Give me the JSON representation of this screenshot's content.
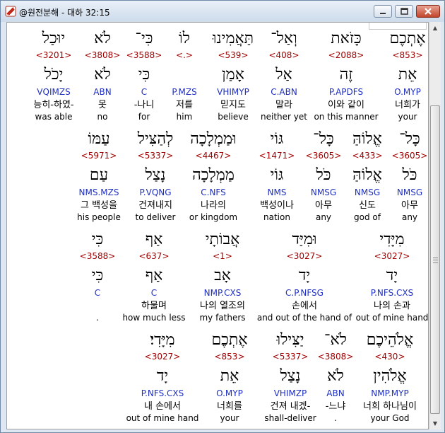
{
  "window": {
    "title": "@원전분해 - 대하 32:15",
    "controls": {
      "minimize": "—",
      "maximize": "□",
      "close": "✕"
    }
  },
  "rows": [
    [
      {
        "heb": "יוּכַל",
        "strong": "<3201>",
        "lemma": "יָכֹל",
        "morph": "VQIMZS",
        "kor": "능히-하였-",
        "eng": "was able"
      },
      {
        "heb": "לֹא",
        "strong": "<3808>",
        "lemma": "לֹא",
        "morph": "ABN",
        "kor": "못",
        "eng": "no"
      },
      {
        "heb": "כִּי־",
        "strong": "<3588>",
        "lemma": "כִּי",
        "morph": "C",
        "kor": "-나니",
        "eng": "for"
      },
      {
        "heb": "לוֹ",
        "strong": "<.>",
        "lemma": "",
        "morph": "P.MZS",
        "kor": "저를",
        "eng": "him"
      },
      {
        "heb": "תַּאֲמִינוּ",
        "strong": "<539>",
        "lemma": "אָמַן",
        "morph": "VHIMYP",
        "kor": "믿지도",
        "eng": "believe"
      },
      {
        "heb": "וְאַל־",
        "strong": "<408>",
        "lemma": "אַל",
        "morph": "C.ABN",
        "kor": "말라",
        "eng": "neither yet"
      },
      {
        "heb": "כָּזֹאת",
        "strong": "<2088>",
        "lemma": "זֶה",
        "morph": "P.APDFS",
        "kor": "이와 같이",
        "eng": "on this manner"
      },
      {
        "heb": "אֶתְכֶם",
        "strong": "<853>",
        "lemma": "אֵת",
        "morph": "O.MYP",
        "kor": "너희가",
        "eng": "your"
      }
    ],
    [
      {
        "heb": "עַמּוֹ",
        "strong": "<5971>",
        "lemma": "עַם",
        "morph": "NMS.MZS",
        "kor": "그 백성을",
        "eng": "his people"
      },
      {
        "heb": "לְהַצִּיל",
        "strong": "<5337>",
        "lemma": "נָצַל",
        "morph": "P.VQNG",
        "kor": "건져내지",
        "eng": "to deliver"
      },
      {
        "heb": "וּמַמְלָכָה",
        "strong": "<4467>",
        "lemma": "מַמְלָכָה",
        "morph": "C.NFS",
        "kor": "나라의",
        "eng": "or kingdom"
      },
      {
        "heb": "גּוֹי",
        "strong": "<1471>",
        "lemma": "גּוֹי",
        "morph": "NMS",
        "kor": "백성이나",
        "eng": "nation"
      },
      {
        "heb": "כָּל־",
        "strong": "<3605>",
        "lemma": "כֹּל",
        "morph": "NMSG",
        "kor": "아무",
        "eng": "any"
      },
      {
        "heb": "אֱלוֹהַּ",
        "strong": "<433>",
        "lemma": "אֱלוֹהַּ",
        "morph": "NMSG",
        "kor": "신도",
        "eng": "god of"
      },
      {
        "heb": "כָּל־",
        "strong": "<3605>",
        "lemma": "כֹּל",
        "morph": "NMSG",
        "kor": "아무",
        "eng": "any"
      }
    ],
    [
      {
        "heb": "כִּי",
        "strong": "<3588>",
        "lemma": "כִּי",
        "morph": "C",
        "kor": "",
        "eng": "."
      },
      {
        "heb": "אַף",
        "strong": "<637>",
        "lemma": "אַף",
        "morph": "C",
        "kor": "하물며",
        "eng": "how much less"
      },
      {
        "heb": "אֲבוֹתָי",
        "strong": "<1>",
        "lemma": "אָב",
        "morph": "NMP.CXS",
        "kor": "나의 열조의",
        "eng": "my fathers"
      },
      {
        "heb": "וּמִיַּד",
        "strong": "<3027>",
        "lemma": "יָד",
        "morph": "C.P.NFSG",
        "kor": "손에서",
        "eng": "and out of the hand of"
      },
      {
        "heb": "מִיָּדִי",
        "strong": "<3027>",
        "lemma": "יָד",
        "morph": "P.NFS.CXS",
        "kor": "나의 손과",
        "eng": "out of mine hand"
      }
    ],
    [
      {
        "heb": "מִיָּדִי׃",
        "strong": "<3027>",
        "lemma": "יָד",
        "morph": "P.NFS.CXS",
        "kor": "내 손에서",
        "eng": "out of mine hand"
      },
      {
        "heb": "אֶתְכֶם",
        "strong": "<853>",
        "lemma": "אֵת",
        "morph": "O.MYP",
        "kor": "너희를",
        "eng": "your"
      },
      {
        "heb": "יַצִּילוּ",
        "strong": "<5337>",
        "lemma": "נָצַל",
        "morph": "VHIMZP",
        "kor": "건져 내겠-",
        "eng": "shall-deliver"
      },
      {
        "heb": "לֹא־",
        "strong": "<3808>",
        "lemma": "לֹא",
        "morph": "ABN",
        "kor": "-느냐",
        "eng": "."
      },
      {
        "heb": "אֱלֹהֵיכֶם",
        "strong": "<430>",
        "lemma": "אֱלֹהִין",
        "morph": "NMP.MYP",
        "kor": "너희 하나님이",
        "eng": "your God"
      }
    ]
  ]
}
